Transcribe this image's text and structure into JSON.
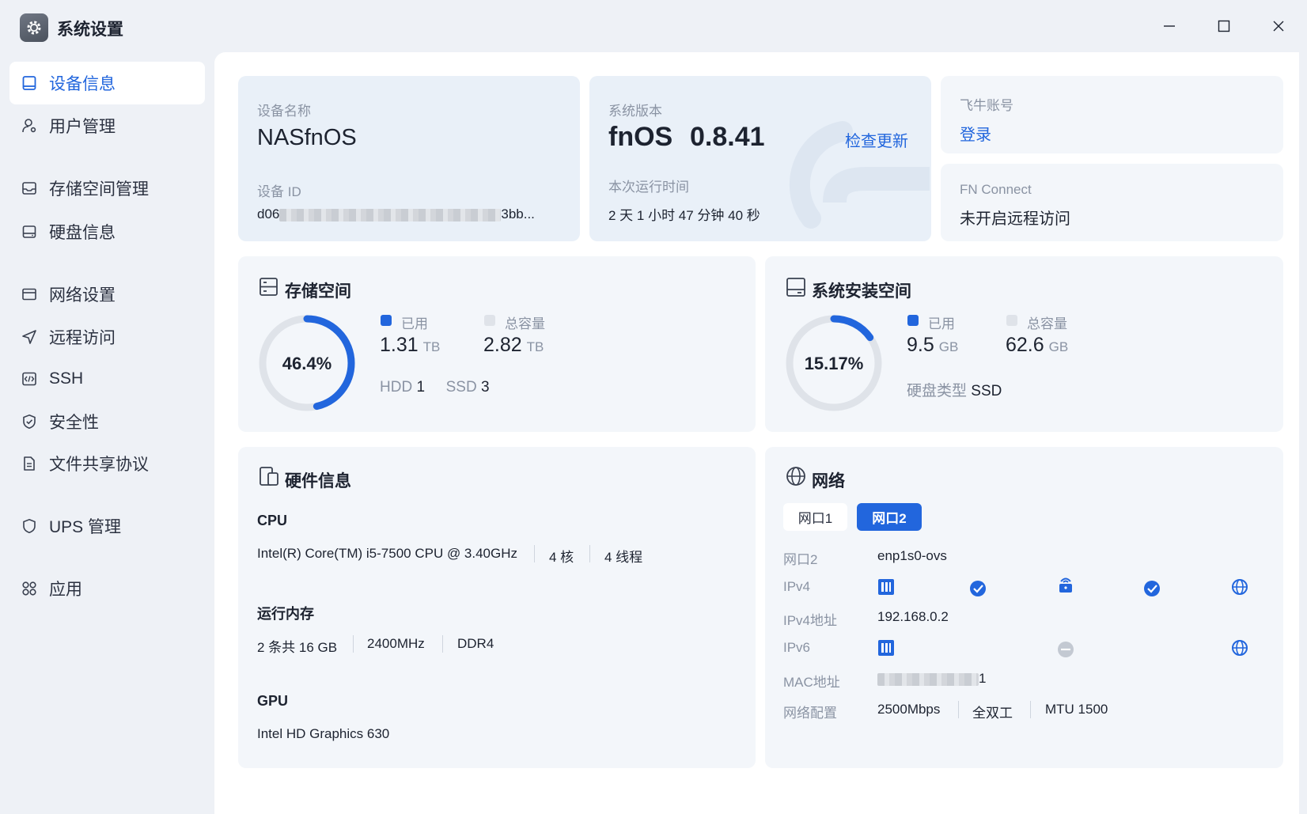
{
  "app": {
    "title": "系统设置",
    "icon": "gear-icon"
  },
  "window_controls": {
    "minimize": "minimize-icon",
    "maximize": "maximize-icon",
    "close": "close-icon"
  },
  "sidebar": {
    "items": [
      {
        "label": "设备信息",
        "icon": "monitor-icon",
        "active": true
      },
      {
        "label": "用户管理",
        "icon": "user-gear-icon"
      },
      {
        "label": "存储空间管理",
        "icon": "storage-icon"
      },
      {
        "label": "硬盘信息",
        "icon": "harddisk-icon"
      },
      {
        "label": "网络设置",
        "icon": "network-window-icon"
      },
      {
        "label": "远程访问",
        "icon": "send-icon"
      },
      {
        "label": "SSH",
        "icon": "code-icon"
      },
      {
        "label": "安全性",
        "icon": "shield-check-icon"
      },
      {
        "label": "文件共享协议",
        "icon": "document-icon"
      },
      {
        "label": "UPS 管理",
        "icon": "shield-icon"
      },
      {
        "label": "应用",
        "icon": "apps-icon"
      }
    ]
  },
  "device": {
    "name_label": "设备名称",
    "name": "NASfnOS",
    "id_label": "设备 ID",
    "id_prefix": "d06",
    "id_suffix": "3bb..."
  },
  "system": {
    "version_label": "系统版本",
    "os": "fnOS",
    "version": "0.8.41",
    "check_update": "检查更新",
    "uptime_label": "本次运行时间",
    "uptime": "2 天 1 小时 47 分钟 40 秒"
  },
  "account": {
    "label": "飞牛账号",
    "login": "登录"
  },
  "fn_connect": {
    "label": "FN Connect",
    "status": "未开启远程访问"
  },
  "storage": {
    "title": "存储空间",
    "percent": "46.4%",
    "used_fraction": 0.464,
    "used_label": "已用",
    "total_label": "总容量",
    "used_value": "1.31",
    "used_unit": "TB",
    "total_value": "2.82",
    "total_unit": "TB",
    "hdd_label": "HDD",
    "hdd_count": "1",
    "ssd_label": "SSD",
    "ssd_count": "3"
  },
  "sys_storage": {
    "title": "系统安装空间",
    "percent": "15.17%",
    "used_fraction": 0.1517,
    "used_label": "已用",
    "total_label": "总容量",
    "used_value": "9.5",
    "used_unit": "GB",
    "total_value": "62.6",
    "total_unit": "GB",
    "disk_type_label": "硬盘类型",
    "disk_type": "SSD"
  },
  "hardware": {
    "title": "硬件信息",
    "cpu_label": "CPU",
    "cpu_model": "Intel(R) Core(TM) i5-7500 CPU @ 3.40GHz",
    "cpu_cores": "4 核",
    "cpu_threads": "4 线程",
    "ram_label": "运行内存",
    "ram_size": "2 条共 16 GB",
    "ram_freq": "2400MHz",
    "ram_type": "DDR4",
    "gpu_label": "GPU",
    "gpu_model": "Intel HD Graphics 630"
  },
  "network": {
    "title": "网络",
    "tabs": [
      {
        "label": "网口1",
        "active": false
      },
      {
        "label": "网口2",
        "active": true
      }
    ],
    "port_label": "网口2",
    "port_value": "enp1s0-ovs",
    "ipv4_label": "IPv4",
    "ipv4_addr_label": "IPv4地址",
    "ipv4_addr": "192.168.0.2",
    "ipv6_label": "IPv6",
    "mac_label": "MAC地址",
    "mac_suffix": "1",
    "config_label": "网络配置",
    "speed": "2500Mbps",
    "duplex": "全双工",
    "mtu": "MTU 1500"
  },
  "colors": {
    "accent": "#2266dd",
    "track": "#dfe3e9",
    "card": "#f3f6fa",
    "card_blue": "#e9f0f8"
  }
}
